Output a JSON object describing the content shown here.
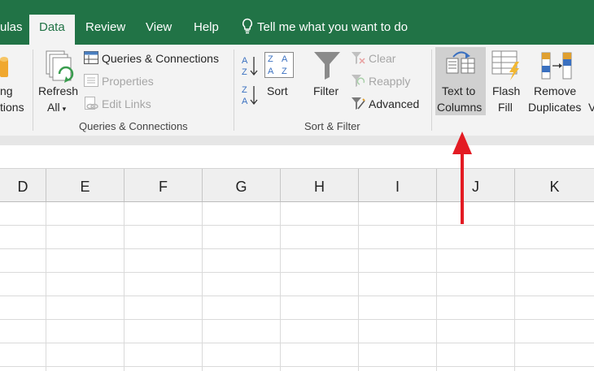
{
  "tabs": [
    {
      "label": "ulas"
    },
    {
      "label": "Data"
    },
    {
      "label": "Review"
    },
    {
      "label": "View"
    },
    {
      "label": "Help"
    }
  ],
  "tell_me": "Tell me what you want to do",
  "ribbon": {
    "get_data_partial": {
      "line1": "ng",
      "line2": "tions"
    },
    "refresh": {
      "line1": "Refresh",
      "line2": "All"
    },
    "queries_connections": "Queries & Connections",
    "properties": "Properties",
    "edit_links": "Edit Links",
    "group_queries": "Queries & Connections",
    "sort": "Sort",
    "filter": "Filter",
    "clear": "Clear",
    "reapply": "Reapply",
    "advanced": "Advanced",
    "group_sort_filter": "Sort & Filter",
    "text_to_columns": {
      "line1": "Text to",
      "line2": "Columns"
    },
    "flash_fill": {
      "line1": "Flash",
      "line2": "Fill"
    },
    "remove_duplicates": {
      "line1": "Remove",
      "line2": "Duplicates"
    },
    "partial_v": "V"
  },
  "columns": [
    "D",
    "E",
    "F",
    "G",
    "H",
    "I",
    "J",
    "K"
  ],
  "colors": {
    "excel_green": "#217346",
    "arrow_red": "#e31b23"
  }
}
